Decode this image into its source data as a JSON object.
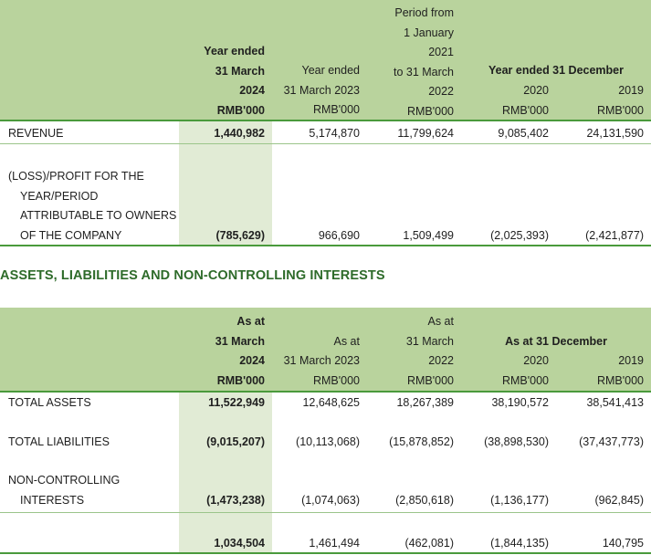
{
  "income": {
    "headers": {
      "col1": [
        "Year ended",
        "31 March",
        "2024",
        "RMB'000"
      ],
      "col2": [
        "Year ended",
        "31 March 2023",
        "RMB'000"
      ],
      "col3": [
        "Period from",
        "1 January",
        "2021",
        "to  31 March",
        "2022",
        "RMB'000"
      ],
      "span45": "Year ended 31 December",
      "col4": [
        "2020",
        "RMB'000"
      ],
      "col5": [
        "2019",
        "RMB'000"
      ]
    },
    "rows": [
      {
        "label": [
          "REVENUE"
        ],
        "values": [
          "1,440,982",
          "5,174,870",
          "11,799,624",
          "9,085,402",
          "24,131,590"
        ]
      },
      {
        "label": [
          "(LOSS)/PROFIT FOR THE",
          "YEAR/PERIOD",
          "ATTRIBUTABLE TO OWNERS",
          "OF THE COMPANY"
        ],
        "values": [
          "(785,629)",
          "966,690",
          "1,509,499",
          "(2,025,393)",
          "(2,421,877)"
        ]
      }
    ]
  },
  "balance": {
    "title": "ASSETS, LIABILITIES AND NON-CONTROLLING INTERESTS",
    "headers": {
      "col1": [
        "As at",
        "31 March",
        "2024",
        "RMB'000"
      ],
      "col2": [
        "As at",
        "31 March 2023",
        "RMB'000"
      ],
      "col3": [
        "As at",
        "31 March",
        "2022",
        "RMB'000"
      ],
      "span45": "As at 31 December",
      "col4": [
        "2020",
        "RMB'000"
      ],
      "col5": [
        "2019",
        "RMB'000"
      ]
    },
    "rows": [
      {
        "label": [
          "TOTAL ASSETS"
        ],
        "values": [
          "11,522,949",
          "12,648,625",
          "18,267,389",
          "38,190,572",
          "38,541,413"
        ]
      },
      {
        "label": [
          "TOTAL LIABILITIES"
        ],
        "values": [
          "(9,015,207)",
          "(10,113,068)",
          "(15,878,852)",
          "(38,898,530)",
          "(37,437,773)"
        ]
      },
      {
        "label": [
          "NON-CONTROLLING",
          "INTERESTS"
        ],
        "values": [
          "(1,473,238)",
          "(1,074,063)",
          "(2,850,618)",
          "(1,136,177)",
          "(962,845)"
        ]
      },
      {
        "label": [],
        "values": [
          "1,034,504",
          "1,461,494",
          "(462,081)",
          "(1,844,135)",
          "140,795"
        ]
      }
    ]
  }
}
